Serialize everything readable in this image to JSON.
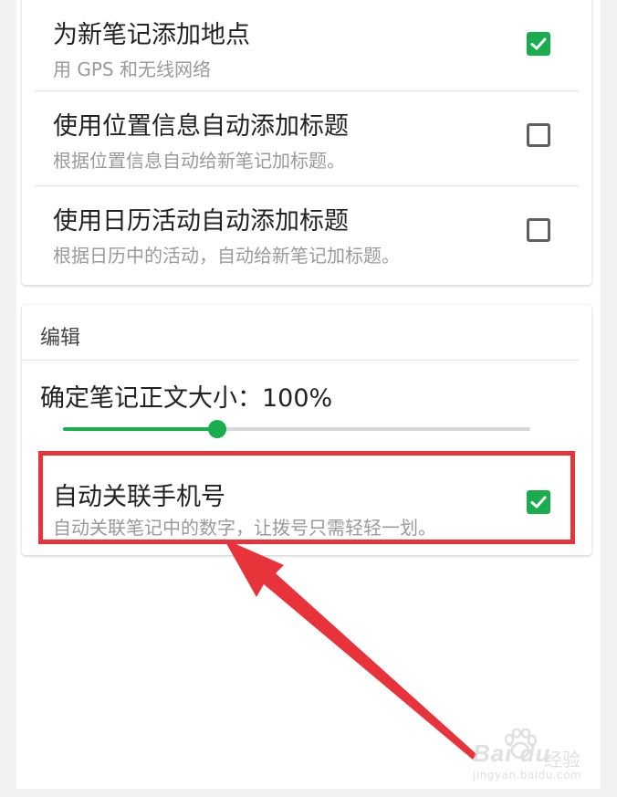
{
  "location_section": {
    "items": [
      {
        "title": "为新笔记添加地点",
        "subtitle": "用 GPS 和无线网络",
        "checked": true
      },
      {
        "title": "使用位置信息自动添加标题",
        "subtitle": "根据位置信息自动给新笔记加标题。",
        "checked": false
      },
      {
        "title": "使用日历活动自动添加标题",
        "subtitle": "根据日历中的活动，自动给新笔记加标题。",
        "checked": false
      }
    ]
  },
  "edit_section": {
    "header": "编辑",
    "font_size": {
      "label": "确定笔记正文大小：100%",
      "level": 0.33
    },
    "auto_link_phone": {
      "title": "自动关联手机号",
      "subtitle": "自动关联笔记中的数字，让拨号只需轻轻一划。",
      "checked": true
    }
  },
  "colors": {
    "accent": "#1aad4e",
    "annotation": "#e8333a"
  },
  "icons": {
    "checkbox_checked": "check-icon",
    "arrow": "arrow-annotation-icon"
  }
}
